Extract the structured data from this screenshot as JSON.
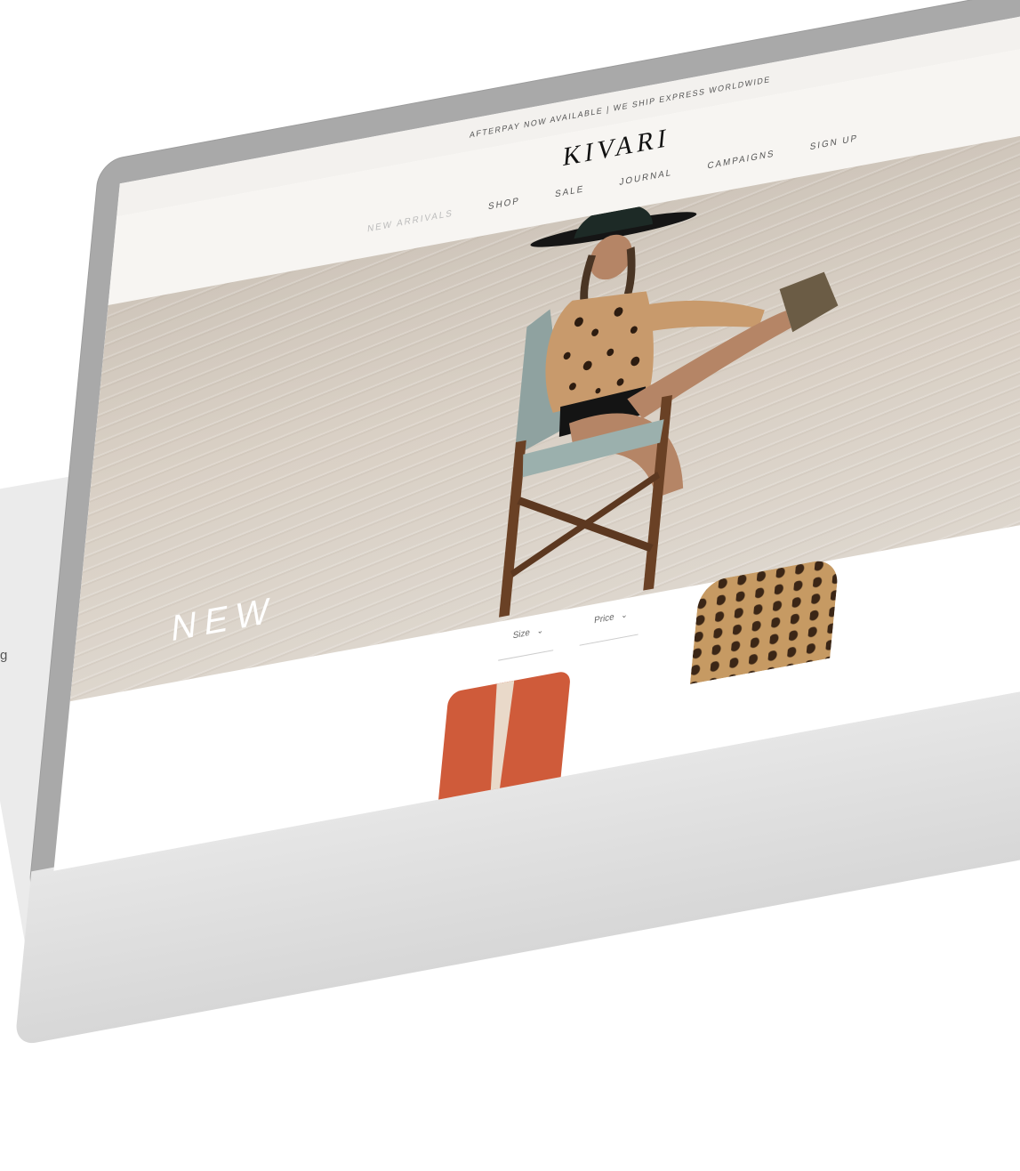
{
  "topbar": {
    "text": "AFTERPAY NOW AVAILABLE | WE SHIP EXPRESS WORLDWIDE"
  },
  "logo": {
    "text": "KIVARI"
  },
  "nav": {
    "items": [
      {
        "label": "NEW ARRIVALS"
      },
      {
        "label": "SHOP"
      },
      {
        "label": "SALE"
      },
      {
        "label": "JOURNAL"
      },
      {
        "label": "CAMPAIGNS"
      },
      {
        "label": "SIGN UP"
      }
    ]
  },
  "hero": {
    "word": "NEW"
  },
  "filters": {
    "size": "Size",
    "price": "Price"
  },
  "edge": {
    "glyph": "g"
  },
  "icons": {
    "apple": "apple-logo-icon",
    "chevron": "chevron-down-icon"
  },
  "colors": {
    "bezel": "#a9a9a9",
    "header_bg": "#f7f5f2",
    "sand": "#d9d0c5"
  }
}
